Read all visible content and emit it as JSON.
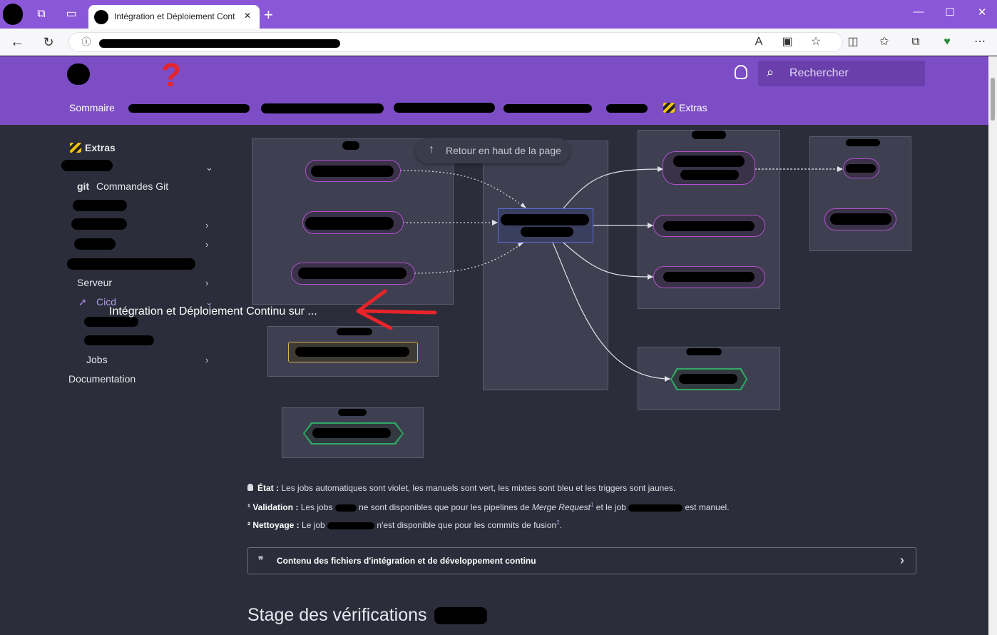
{
  "browser": {
    "tab_title": "Intégration et Déploiement Cont",
    "tab_close": "✕",
    "new_tab": "+"
  },
  "header": {
    "nav": [
      "Sommaire",
      "Extras"
    ],
    "search_placeholder": "Rechercher"
  },
  "sidebar": {
    "section": "Extras",
    "items": [
      {
        "label": "git",
        "sub": "Commandes Git"
      },
      {
        "label": "Serveur"
      },
      {
        "label": "Cicd"
      },
      {
        "label": "Jobs"
      },
      {
        "label": "Documentation"
      }
    ]
  },
  "tooltip": "Intégration et Déploiement Continu sur ...",
  "back_to_top": "Retour en haut de la page",
  "notes": {
    "etat_label": "État :",
    "etat_text": "Les jobs automatiques sont violet, les manuels sont vert, les mixtes sont bleu et les triggers sont jaunes.",
    "validation_label": "¹ Validation :",
    "validation_a": "Les jobs",
    "validation_b": "ne sont disponibles que pour les pipelines de",
    "validation_italic": "Merge Request",
    "validation_sup": "1",
    "validation_c": "et le job",
    "validation_d": "est manuel.",
    "nettoyage_label": "² Nettoyage :",
    "nettoyage_a": "Le job",
    "nettoyage_b": "n'est disponible que pour les commits de fusion",
    "nettoyage_sup": "2",
    "nettoyage_end": "."
  },
  "collapse": {
    "quote": "❞",
    "label": "Contenu des fichiers d'intégration et de développement continu",
    "chevron": "›"
  },
  "stage_title": "Stage des vérifications"
}
